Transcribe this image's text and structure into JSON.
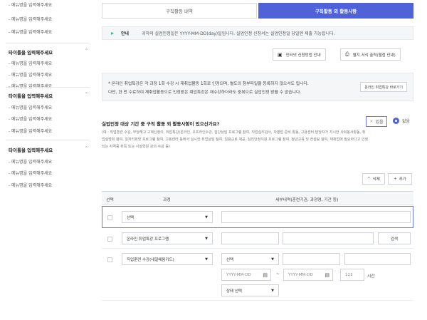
{
  "sidebar": {
    "groups": [
      {
        "title": "",
        "items": [
          "- 메뉴명을 입력해주세요",
          "- 메뉴명을 입력해주세요",
          "- 메뉴명을 입력해주세요"
        ]
      },
      {
        "title": "타이틀을 입력해주세요",
        "items": [
          "- 메뉴명을 입력해주세요",
          "- 메뉴명을 입력해주세요",
          "- 메뉴명을 입력해주세요"
        ]
      },
      {
        "title": "타이틀을 입력해주세요",
        "items": [
          "- 메뉴명을 입력해주세요",
          "- 메뉴명을 입력해주세요",
          "- 메뉴명을 입력해주세요"
        ]
      },
      {
        "title": "타이틀을 입력해주세요",
        "items": [
          "- 메뉴명을 입력해주세요",
          "- 메뉴명을 입력해주세요",
          "- 메뉴명을 입력해주세요"
        ]
      }
    ],
    "caret": "^"
  },
  "tabs": [
    "구직활동 내역",
    "구직활동 외 활동사항"
  ],
  "notice": {
    "label": "안내",
    "text": "귀하의 실업인정일은 YYYY-MM-DD(day)일입니다. 실업인정 신청서는 실업인정일 당일엔 제출 가능합니다."
  },
  "buttons": {
    "guide": "인터넷 신청방법 안내",
    "print": "별지 서식 출력(웹접 안내)",
    "info_side": "온라인 취업특강 바로가기",
    "delete": "삭제",
    "add": "추가",
    "delete_icon": "^",
    "add_icon": "+",
    "search": "검색"
  },
  "info": {
    "line1": "* 온라인 취업특강은 각 과정 1회 수강 시 재취업활동 1회로 인정되며, 별도의 첨부파일을 등록하지 않으셔도 됩니다.",
    "line2": "다만, 한 번 수료하여 재취업활동으로 인정받은 취업특강은 재수강하더라도 중복으로 실업인정 받을 수 없습니다."
  },
  "question": {
    "text": "실업인정 대상 기간 중 구직 활동 외 활동사항이 있으신가요?",
    "yes": "있음",
    "no": "없음",
    "yes_mark": "×",
    "desc1": "(예 : 직업훈련 수강, 부당해고 구제신청의, 취업특강(온라인, 오프라인수강, 집단상담 프로그램 참여, 직업심리검사, 자영업 준비 활동, 고용센터 담당자가 지시한 사회봉사활동, 취",
    "desc2": "업설명회 참여, 일자리희망 프로그램 참여, 고용센터 등에서 실시한 취업상담 참여, 일용근로 재공, 심리안정지원 프로그램 참여, 청년교육 및 컨설팅 참여, 재취업에 필요하다고 인정",
    "desc3": "되는 자격증 취득 또는 사설학원 강의 수강 등)"
  },
  "table": {
    "headers": [
      "선택",
      "과정",
      "세부내역(훈련기관, 과정명, 기간 등)"
    ],
    "rows": [
      {
        "course": "선택"
      },
      {
        "course": "온라인 취업특강 프로그램",
        "search": "검색"
      },
      {
        "course": "직업훈련 수강(내일배움카드)",
        "detail_select": "선택",
        "date_from": "YYYY-MM-DD",
        "date_to": "YYYY-MM-DD",
        "hours": "123",
        "hours_unit": "시간",
        "status": "상태 선택"
      }
    ]
  },
  "colors": {
    "accent": "#4f62d8",
    "notice_icon": "#43b38a"
  }
}
